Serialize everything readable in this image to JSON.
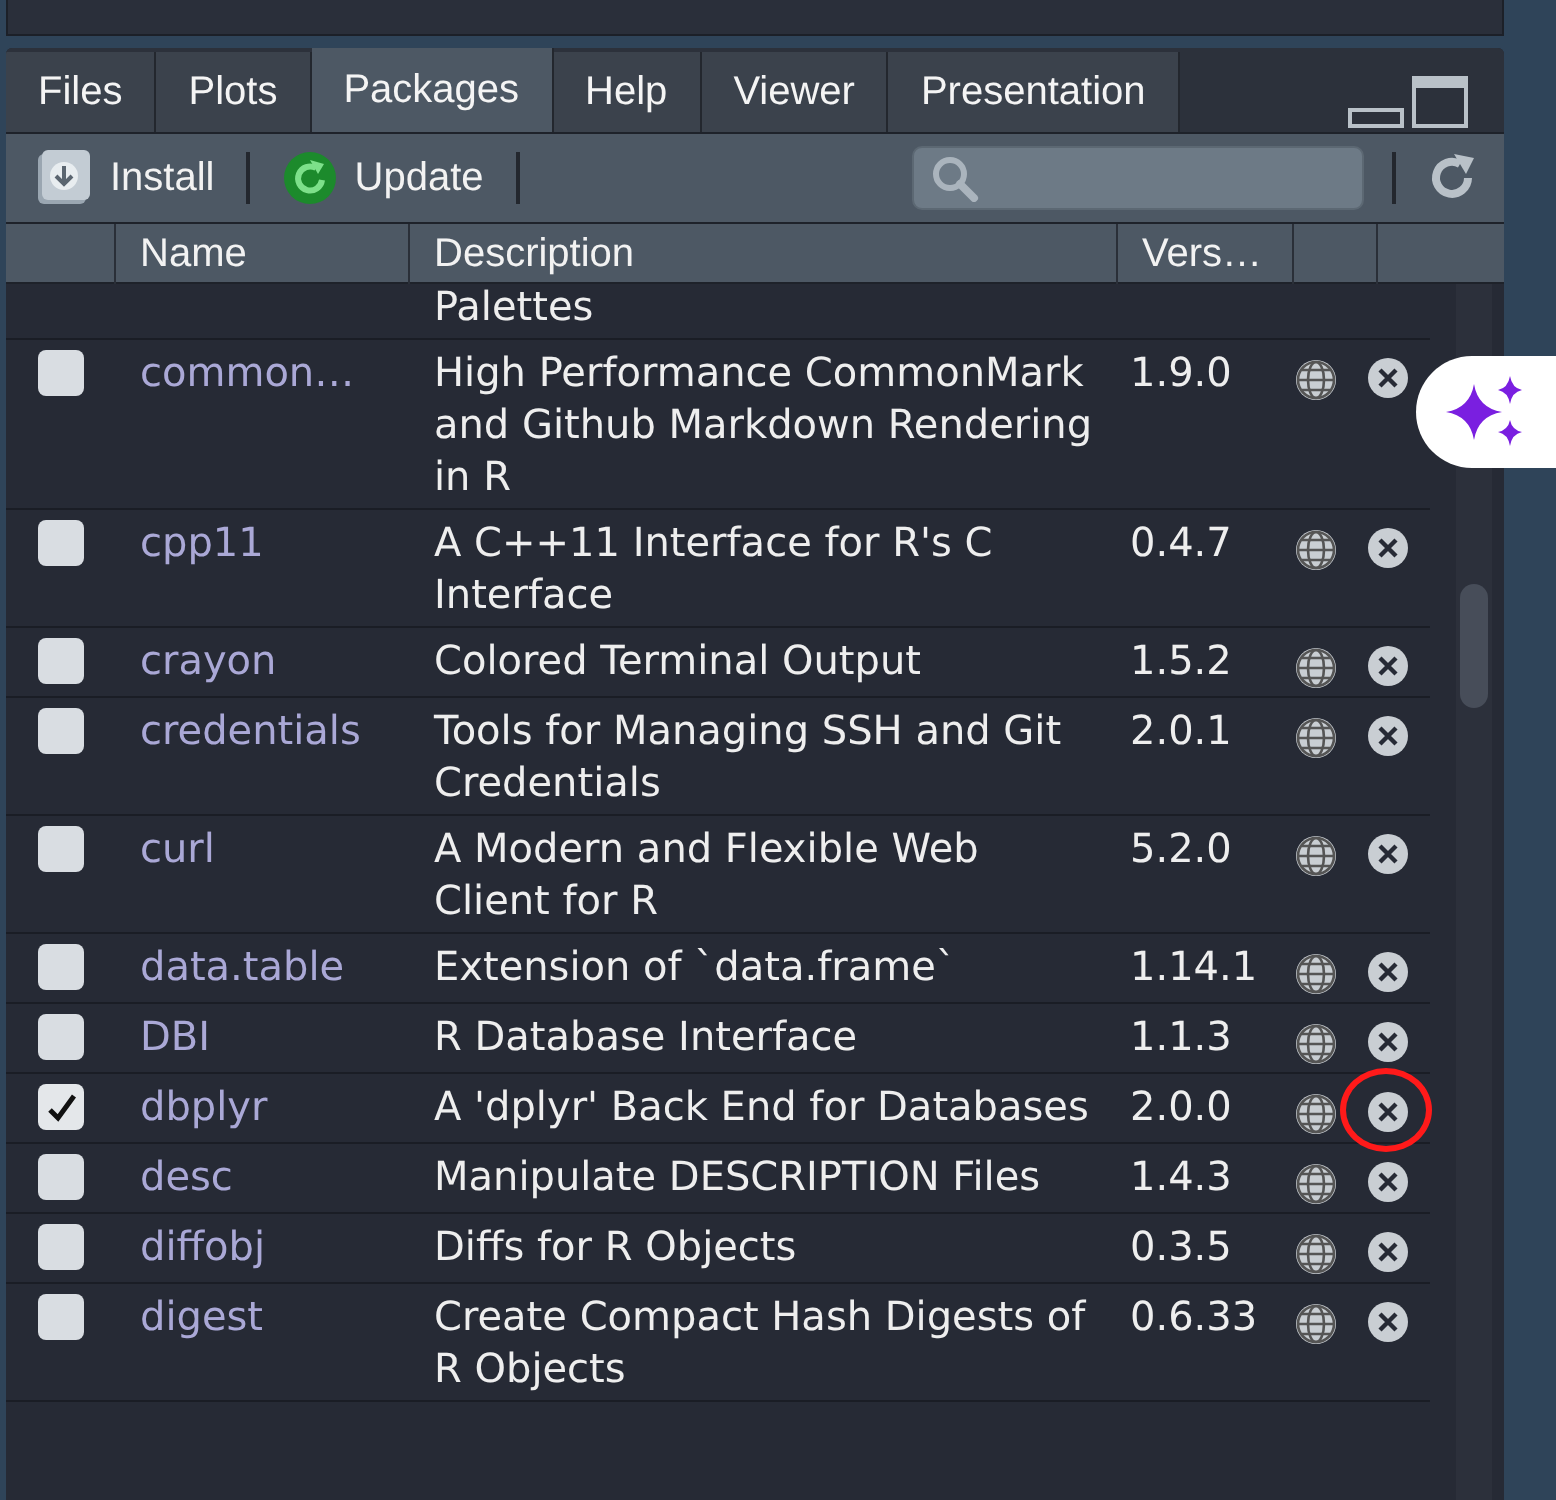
{
  "tabs": [
    {
      "label": "Files",
      "selected": false
    },
    {
      "label": "Plots",
      "selected": false
    },
    {
      "label": "Packages",
      "selected": true
    },
    {
      "label": "Help",
      "selected": false
    },
    {
      "label": "Viewer",
      "selected": false
    },
    {
      "label": "Presentation",
      "selected": false
    }
  ],
  "toolbar": {
    "install": "Install",
    "update": "Update"
  },
  "table": {
    "columns": [
      "Name",
      "Description",
      "Vers…"
    ],
    "rows": [
      {
        "description": "Palettes",
        "partial": true
      },
      {
        "name": "common…",
        "description": "High Performance CommonMark and Github Markdown Rendering in R",
        "version": "1.9.0",
        "checked": false
      },
      {
        "name": "cpp11",
        "description": "A C++11 Interface for R's C Interface",
        "version": "0.4.7",
        "checked": false
      },
      {
        "name": "crayon",
        "description": "Colored Terminal Output",
        "version": "1.5.2",
        "checked": false
      },
      {
        "name": "credentials",
        "description": "Tools for Managing SSH and Git Credentials",
        "version": "2.0.1",
        "checked": false
      },
      {
        "name": "curl",
        "description": "A Modern and Flexible Web Client for R",
        "version": "5.2.0",
        "checked": false
      },
      {
        "name": "data.table",
        "description": "Extension of `data.frame`",
        "version": "1.14.1",
        "checked": false
      },
      {
        "name": "DBI",
        "description": "R Database Interface",
        "version": "1.1.3",
        "checked": false
      },
      {
        "name": "dbplyr",
        "description": "A 'dplyr' Back End for Databases",
        "version": "2.0.0",
        "checked": true,
        "circled": true
      },
      {
        "name": "desc",
        "description": "Manipulate DESCRIPTION Files",
        "version": "1.4.3",
        "checked": false
      },
      {
        "name": "diffobj",
        "description": "Diffs for R Objects",
        "version": "0.3.5",
        "checked": false
      },
      {
        "name": "digest",
        "description": "Create Compact Hash Digests of R Objects",
        "version": "0.6.33",
        "checked": false
      }
    ]
  }
}
